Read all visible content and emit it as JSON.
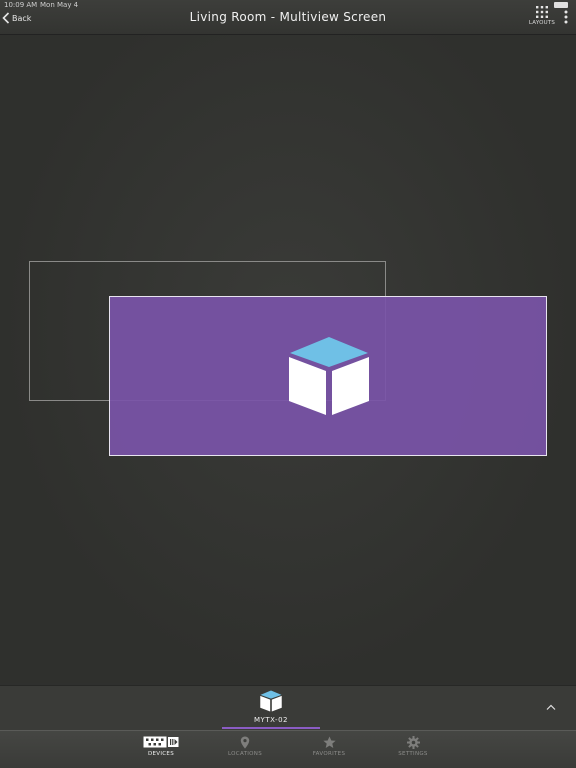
{
  "status_bar": {
    "time": "10:09 AM",
    "date": "Mon May 4",
    "battery": ""
  },
  "header": {
    "back_label": "Back",
    "title": "Living Room - Multiview Screen",
    "layouts_label": "LAYOUTS"
  },
  "source_bar": {
    "sources": [
      {
        "name": "MYTX-02",
        "selected": true
      }
    ]
  },
  "tabbar": {
    "tabs": [
      {
        "label": "DEVICES",
        "active": true
      },
      {
        "label": "LOCATIONS",
        "active": false
      },
      {
        "label": "FAVORITES",
        "active": false
      },
      {
        "label": "SETTINGS",
        "active": false
      }
    ]
  },
  "colors": {
    "accent_purple": "#7a54a8",
    "cube_top": "#6fc0e6",
    "background": "#2f302e"
  }
}
